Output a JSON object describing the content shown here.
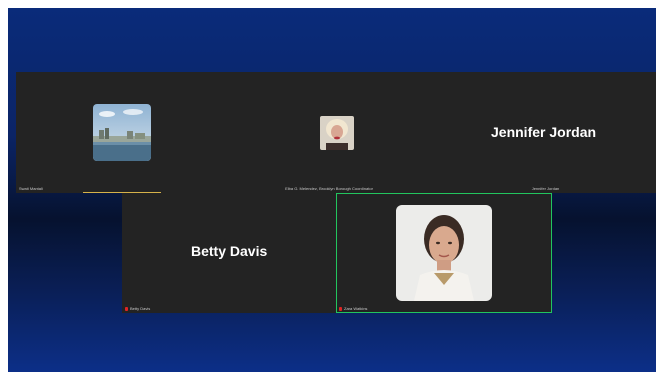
{
  "participants": {
    "top_row": [
      {
        "label": "Swati Mantali"
      },
      {
        "label": "Elba G. Melendez, Brooklyn Borough Coordinator"
      },
      {
        "label": "Jennifer Jordan",
        "display_name": "Jennifer Jordan"
      }
    ],
    "bottom_row": [
      {
        "label": "Betty Davis",
        "display_name": "Betty Davis"
      },
      {
        "label": "Zara Watkins"
      }
    ]
  },
  "colors": {
    "tile_bg": "#232323",
    "active_speaker_border": "#22c55e",
    "muted_mic": "#e02424",
    "background_top": "#0a2b7a",
    "background_mid": "#06122f"
  },
  "icons": {
    "muted_mic": "microphone-muted-icon"
  }
}
